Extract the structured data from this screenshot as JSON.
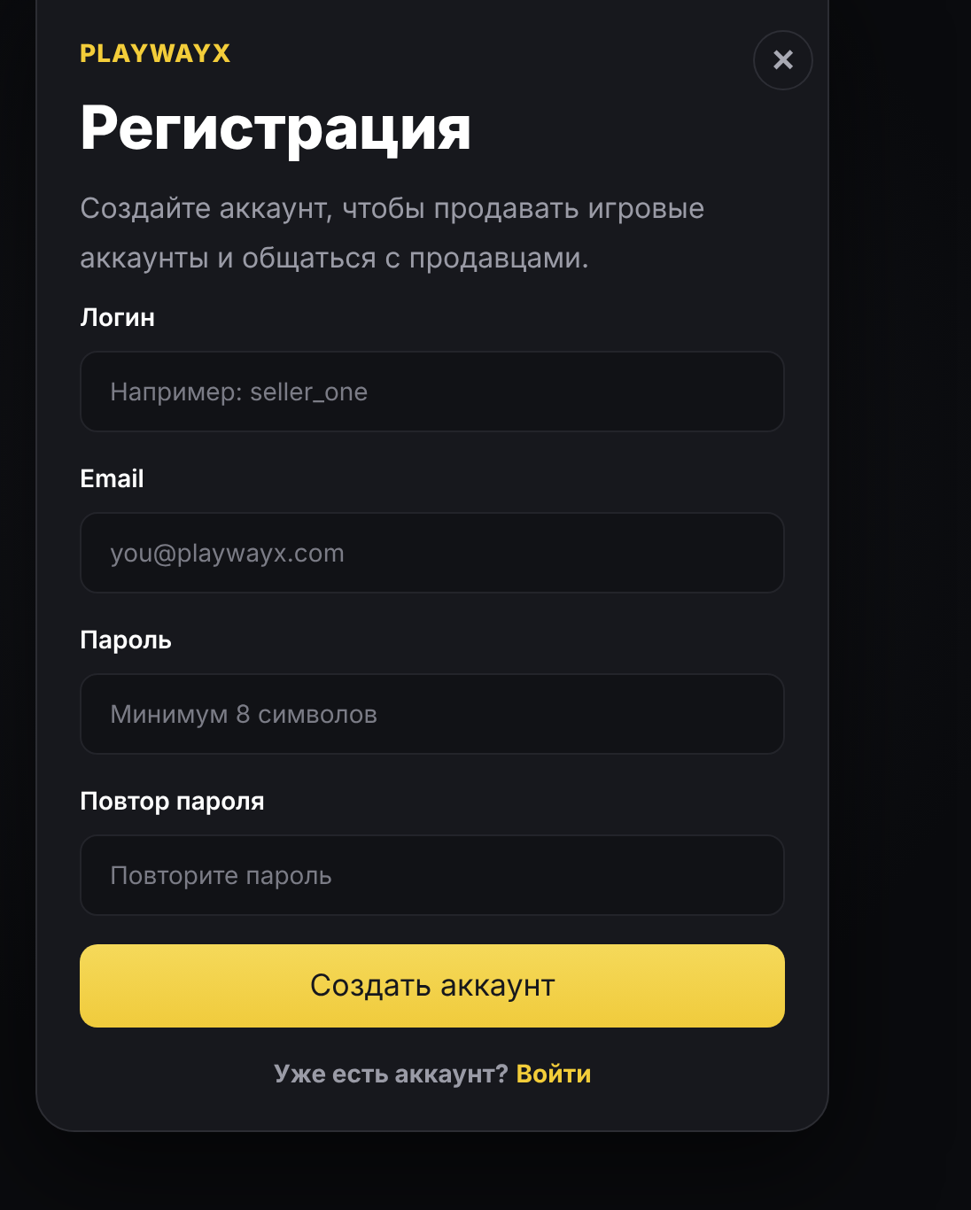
{
  "brand": "PLAYWAYX",
  "close_button": "×",
  "title": "Регистрация",
  "subtitle": "Создайте аккаунт, чтобы продавать игровые аккаунты и общаться с продавцами.",
  "fields": [
    {
      "label": "Логин",
      "placeholder": "Например: seller_one"
    },
    {
      "label": "Email",
      "placeholder": "you@playwayx.com"
    },
    {
      "label": "Пароль",
      "placeholder": "Минимум 8 символов"
    },
    {
      "label": "Повтор пароля",
      "placeholder": "Повторите пароль"
    }
  ],
  "submit_button": "Создать аккаунт",
  "footer": {
    "text": "Уже есть аккаунт?",
    "link": "Войти"
  }
}
